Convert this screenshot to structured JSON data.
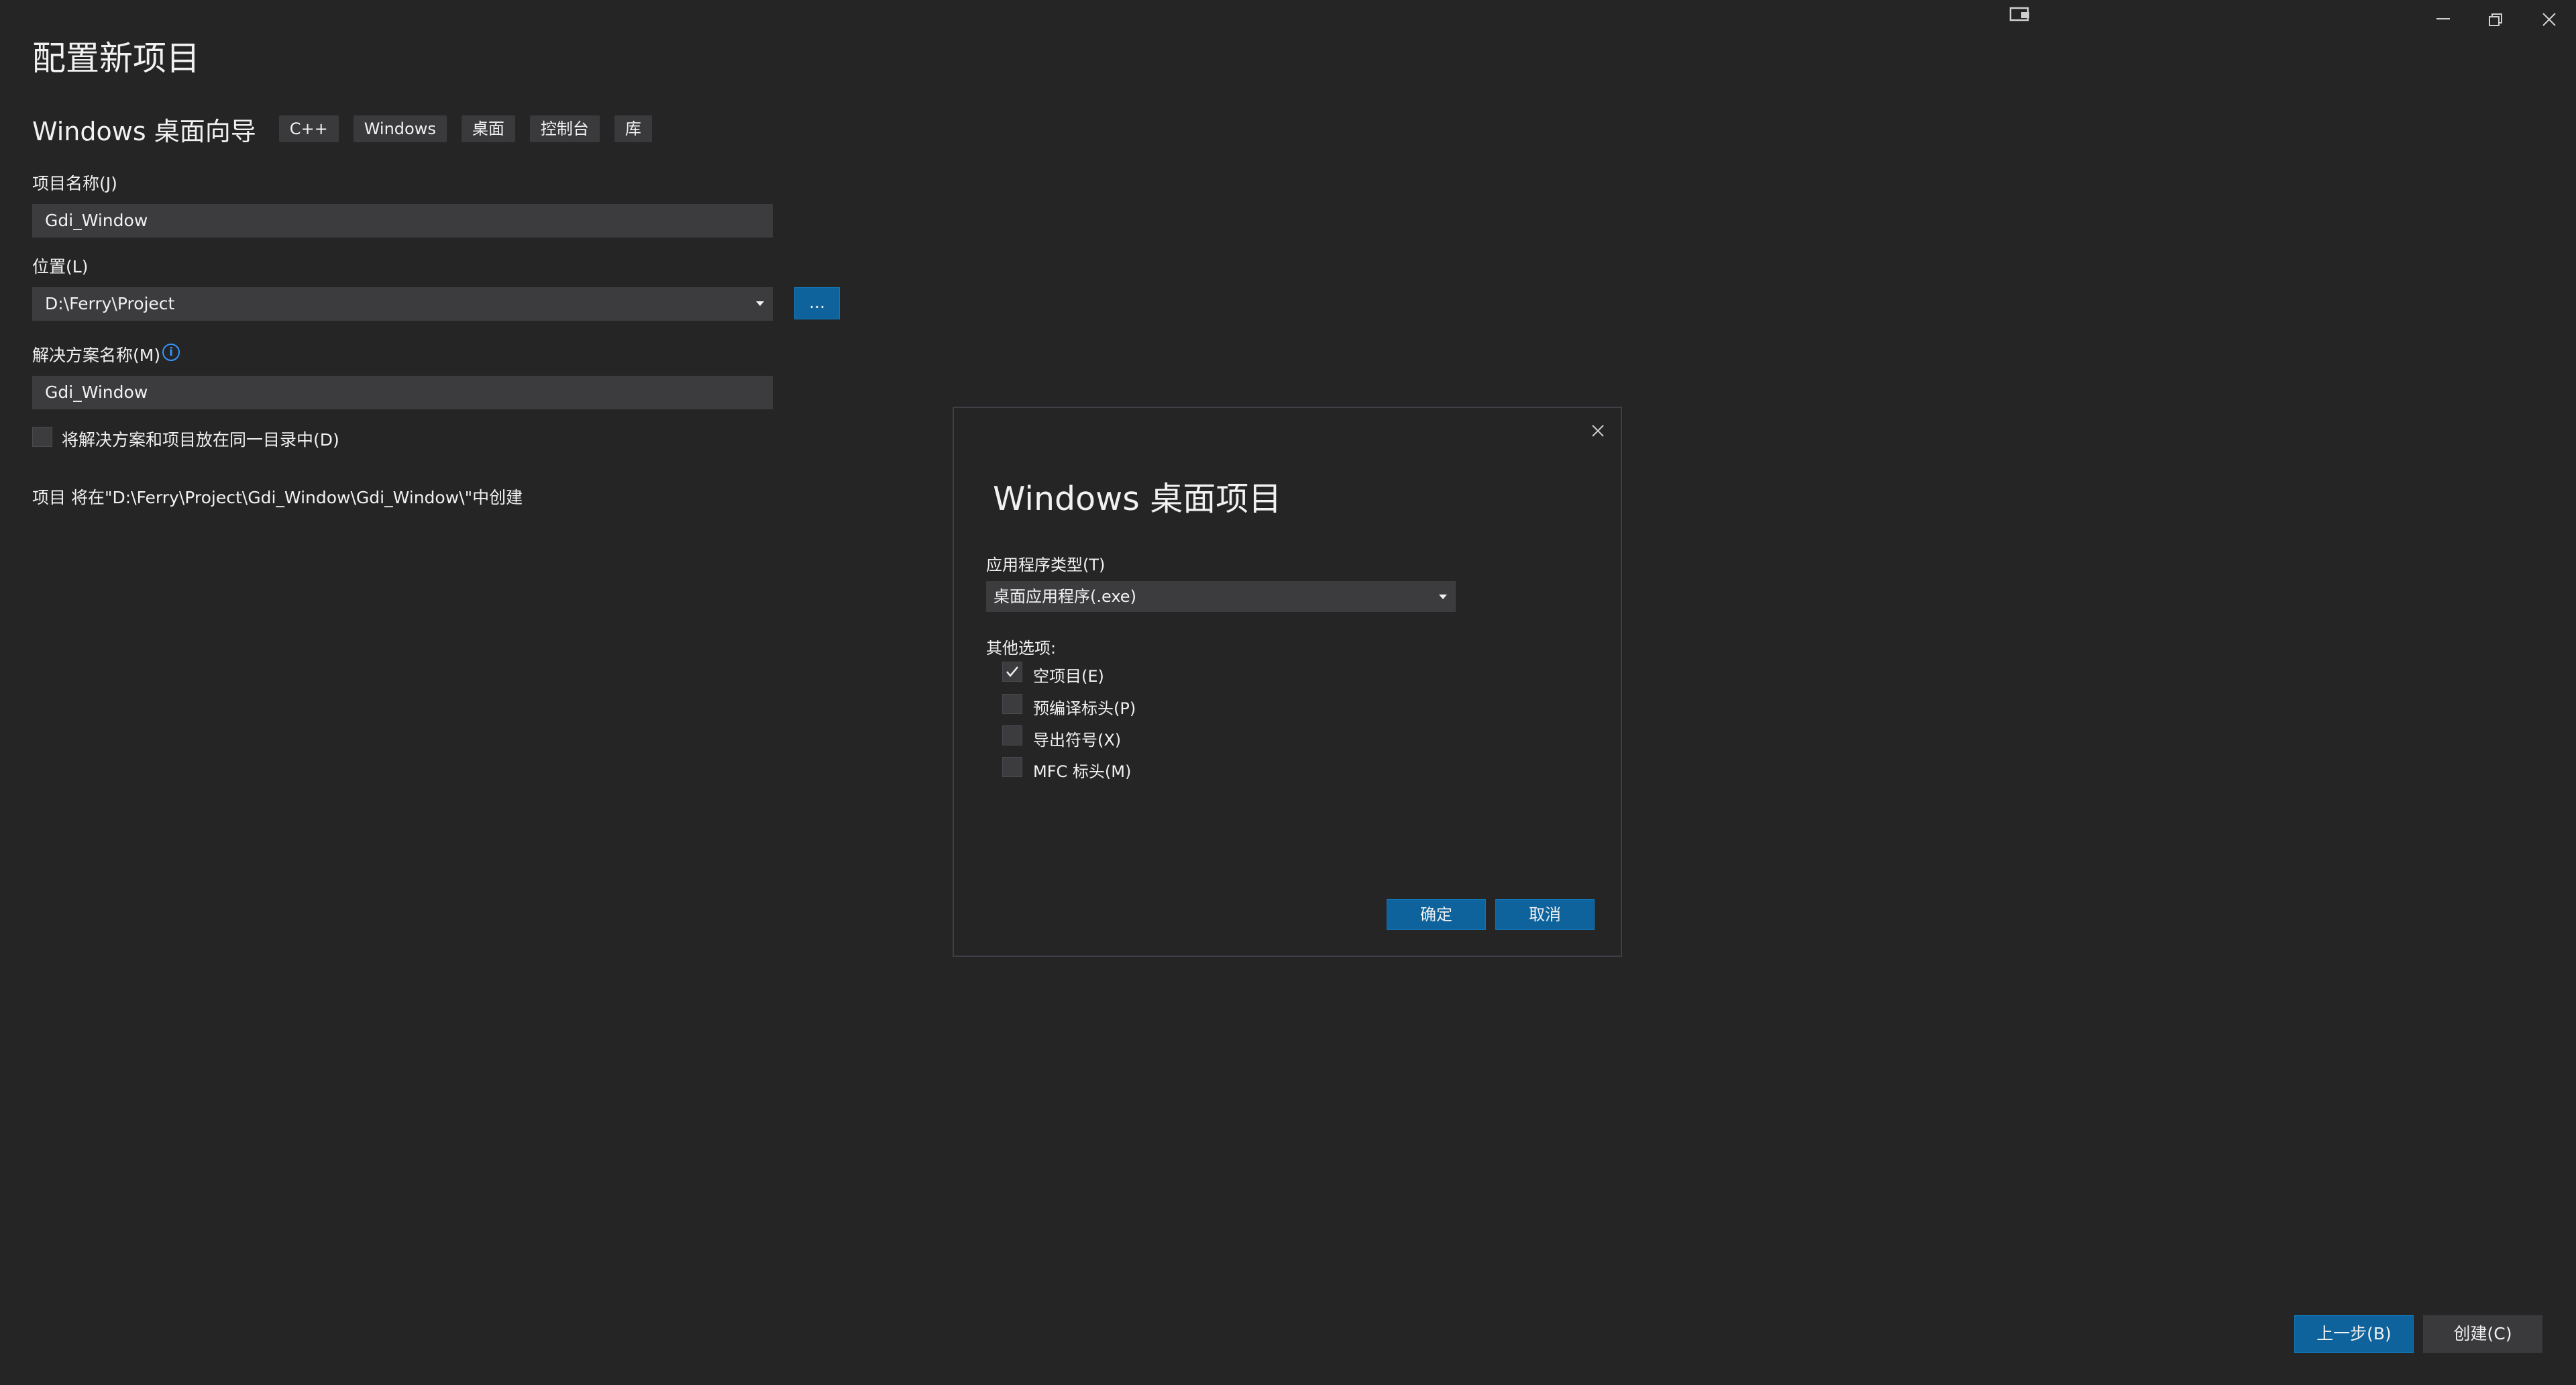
{
  "page": {
    "title": "配置新项目",
    "template_name": "Windows 桌面向导",
    "tags": [
      "C++",
      "Windows",
      "桌面",
      "控制台",
      "库"
    ]
  },
  "form": {
    "project_name_label": "项目名称(J)",
    "project_name_value": "Gdi_Window",
    "location_label": "位置(L)",
    "location_value": "D:\\Ferry\\Project",
    "browse_label": "...",
    "solution_name_label": "解决方案名称(M)",
    "info_icon_glyph": "i",
    "solution_name_value": "Gdi_Window",
    "same_dir_label": "将解决方案和项目放在同一目录中(D)",
    "same_dir_checked": false,
    "creation_path_text": "项目 将在\"D:\\Ferry\\Project\\Gdi_Window\\Gdi_Window\\\"中创建"
  },
  "footer": {
    "back_label": "上一步(B)",
    "create_label": "创建(C)"
  },
  "dialog": {
    "title": "Windows 桌面项目",
    "app_type_label": "应用程序类型(T)",
    "app_type_value": "桌面应用程序(.exe)",
    "other_options_label": "其他选项:",
    "options": [
      {
        "label": "空项目(E)",
        "checked": true
      },
      {
        "label": "预编译标头(P)",
        "checked": false
      },
      {
        "label": "导出符号(X)",
        "checked": false
      },
      {
        "label": "MFC 标头(M)",
        "checked": false
      }
    ],
    "ok_label": "确定",
    "cancel_label": "取消"
  },
  "colors": {
    "background": "#252526",
    "input_bg": "#3c3c3f",
    "accent": "#0e639c",
    "text": "#f1f1f1",
    "info": "#3794ff"
  },
  "icons": [
    "feedback-icon",
    "minimize-icon",
    "restore-icon",
    "close-icon",
    "dropdown-arrow-icon",
    "info-icon",
    "checkmark-icon"
  ]
}
